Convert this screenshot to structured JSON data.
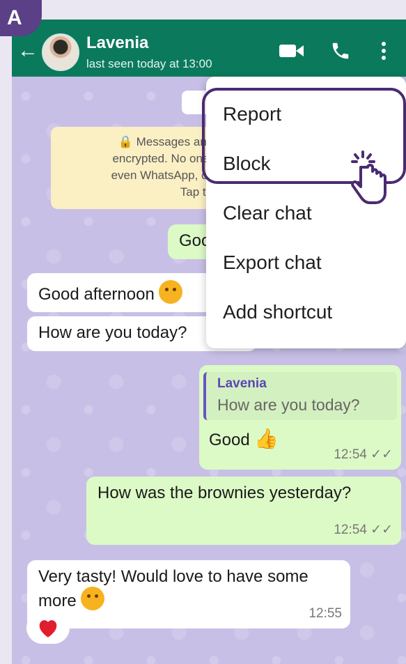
{
  "badge": {
    "label": "A"
  },
  "header": {
    "name": "Lavenia",
    "status": "last seen today at 13:00"
  },
  "chat": {
    "date_pill": "To",
    "notice": {
      "lines": [
        "🔒 Messages and",
        "encrypted. No one o",
        "even WhatsApp, can",
        "Tap to le"
      ]
    },
    "messages": {
      "out_good_partial": "Goo",
      "good_afternoon": "Good afternoon",
      "how_are_you": "How are you today?",
      "reply_good": {
        "quote_name": "Lavenia",
        "quote_text": "How are you today?",
        "text": "Good",
        "time": "12:54 ✓✓"
      },
      "brownies": {
        "text": "How was the brownies yesterday?",
        "time": "12:54 ✓✓"
      },
      "very_tasty": {
        "text": "Very tasty! Would love to have some more",
        "time": "12:55"
      }
    }
  },
  "menu": {
    "items": [
      "Report",
      "Block",
      "Clear chat",
      "Export chat",
      "Add shortcut"
    ]
  },
  "colors": {
    "appbar": "#0b7a5c",
    "chat_bg": "#c8bfe6",
    "outgoing_bubble": "#dcfac6",
    "incoming_bubble": "#ffffff",
    "highlight_border": "#4a2b72",
    "badge": "#5b3f87"
  },
  "icons": [
    "back-arrow-icon",
    "video-call-icon",
    "voice-call-icon",
    "more-options-icon",
    "lock-icon",
    "thumbs-up-icon",
    "smile-emoji-icon",
    "heart-icon",
    "tap-hand-icon"
  ]
}
